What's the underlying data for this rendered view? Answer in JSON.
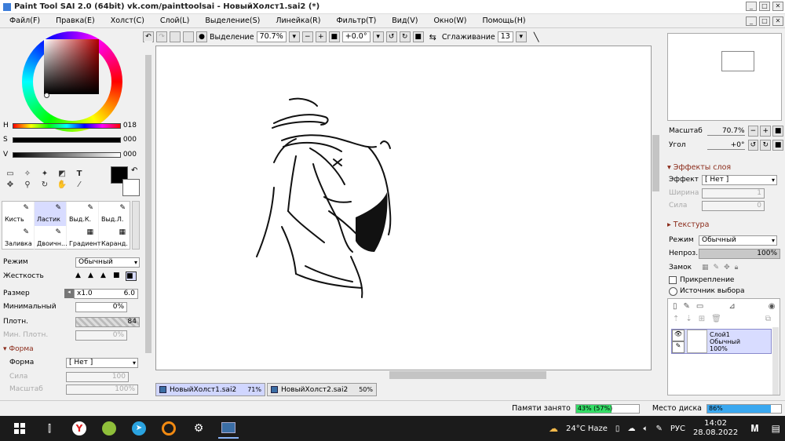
{
  "window": {
    "title": "Paint Tool SAI 2.0 (64bit) vk.com/painttoolsai - НовыйХолст1.sai2 (*)",
    "min_label": "_",
    "max_label": "□",
    "close_label": "✕"
  },
  "menu": {
    "items": [
      "Файл(F)",
      "Правка(E)",
      "Холст(C)",
      "Слой(L)",
      "Выделение(S)",
      "Линейка(R)",
      "Фильтр(T)",
      "Вид(V)",
      "Окно(W)",
      "Помощь(H)"
    ]
  },
  "toolbar": {
    "selection_label": "Выделение",
    "zoom": "70.7%",
    "angle": "+0.0°",
    "smoothing_label": "Сглаживание",
    "smoothing_value": "13"
  },
  "color": {
    "h_label": "H",
    "h_value": "018",
    "s_label": "S",
    "s_value": "000",
    "v_label": "V",
    "v_value": "000",
    "hue_position": 0.05,
    "saturation": 0.0,
    "value": 0.0
  },
  "brushes": [
    {
      "label": "Кисть",
      "icon": "brush-icon"
    },
    {
      "label": "Ластик",
      "icon": "eraser-icon",
      "selected": true
    },
    {
      "label": "Выд.К.",
      "icon": "select-brush-icon"
    },
    {
      "label": "Выд.Л.",
      "icon": "select-eraser-icon"
    },
    {
      "label": "Заливка",
      "icon": "fill-icon"
    },
    {
      "label": "Двоичн...",
      "icon": "binary-pen-icon"
    },
    {
      "label": "Градиент",
      "icon": "gradient-icon"
    },
    {
      "label": "Каранд.",
      "icon": "pencil-icon"
    }
  ],
  "brush_props": {
    "mode_label": "Режим",
    "mode_value": "Обычный",
    "hardness_label": "Жесткость",
    "size_label": "Размер",
    "size_mult": "x1.0",
    "size_value": "6.0",
    "min_label": "Минимальный",
    "min_value": "0%",
    "density_label": "Плотн.",
    "density_value": "84",
    "min_density_label": "Мин. Плотн.",
    "min_density_value": "0%",
    "shape_section": "Форма",
    "shape_label": "Форма",
    "shape_value": "[ Нет ]",
    "strength_label": "Сила",
    "strength_value": "100",
    "scale_label": "Масштаб",
    "scale_value": "100%"
  },
  "doc_tabs": [
    {
      "name": "НовыйХолст1.sai2",
      "zoom": "71%",
      "active": true
    },
    {
      "name": "НовыйХолст2.sai2",
      "zoom": "50%",
      "active": false
    }
  ],
  "navigator": {
    "scale_label": "Масштаб",
    "scale_value": "70.7%",
    "angle_label": "Угол",
    "angle_value": "+0°"
  },
  "layer_effects": {
    "section": "Эффекты слоя",
    "effect_label": "Эффект",
    "effect_value": "[ Нет ]",
    "width_label": "Ширина",
    "width_value": "1",
    "strength_label": "Сила",
    "strength_value": "0",
    "texture_section": "Текстура"
  },
  "layer_props": {
    "mode_label": "Режим",
    "mode_value": "Обычный",
    "opacity_label": "Непроз.",
    "opacity_value": "100%",
    "lock_label": "Замок",
    "clip_label": "Прикрепление",
    "source_label": "Источник выбора"
  },
  "layer": {
    "name": "Слой1",
    "mode": "Обычный",
    "opacity": "100%"
  },
  "status": {
    "memory_label": "Памяти занято",
    "memory_value": "43% (57%)",
    "memory_fill": 0.57,
    "disk_label": "Место диска",
    "disk_value": "86%",
    "disk_fill": 0.86
  },
  "taskbar": {
    "weather": "24°C  Haze",
    "lang": "РУС",
    "time": "14:02",
    "date": "28.08.2022"
  }
}
